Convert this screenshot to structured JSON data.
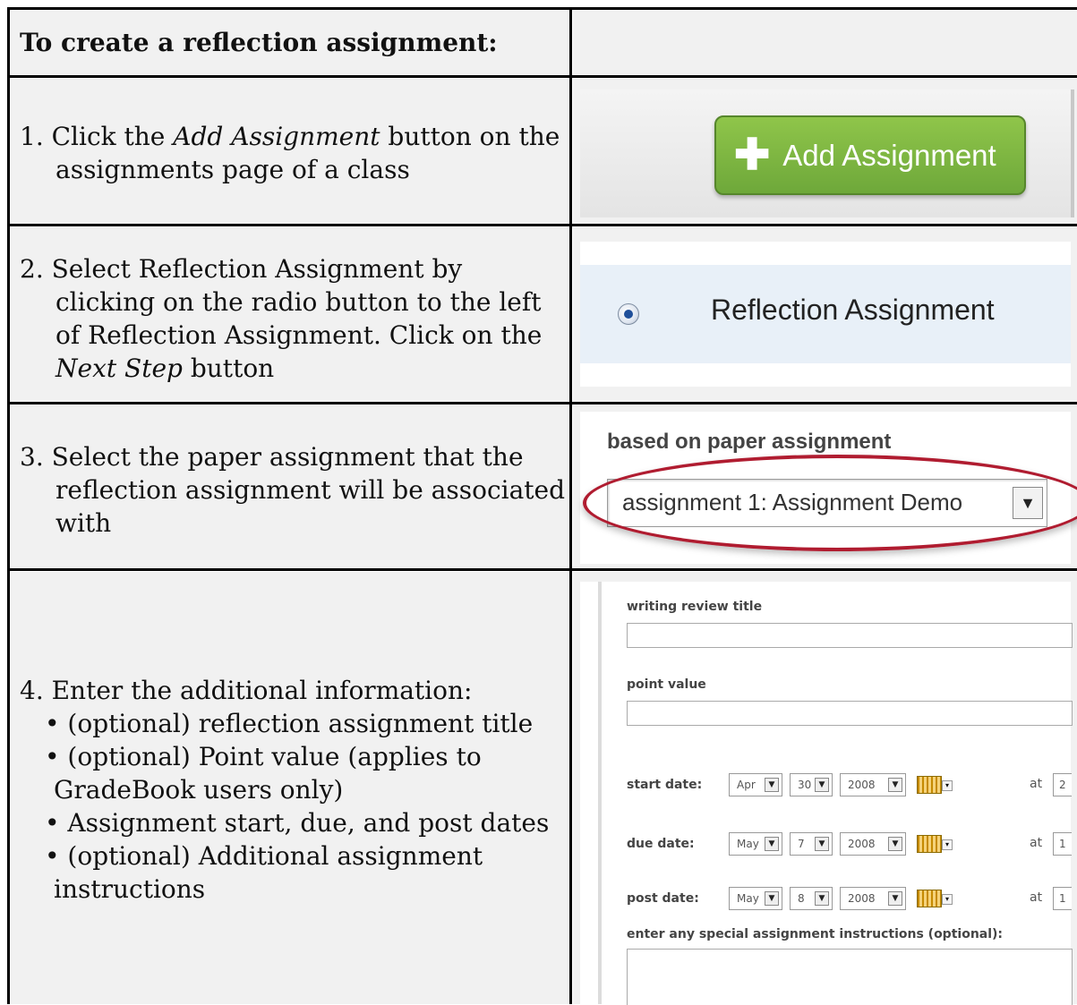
{
  "heading": "To create a reflection assignment:",
  "steps": {
    "s1": {
      "pre": "1. Click the ",
      "em": "Add Assignment",
      "post": " button on the",
      "line2": "assignments page of a class"
    },
    "s2": {
      "l1": "2. Select Reflection Assignment by",
      "l2": "clicking on the radio button to the left",
      "l3": "of Reflection Assignment. Click on the",
      "l4em": "Next Step",
      "l4post": " button"
    },
    "s3": {
      "l1": "3. Select the paper assignment that the",
      "l2": "reflection assignment will be associated",
      "l3": "with"
    },
    "s4": {
      "l1": "4. Enter the additional information:",
      "b1": "• (optional) reflection assignment title",
      "b2a": "• (optional) Point value (applies to",
      "b2b": "GradeBook users only)",
      "b3": "• Assignment start, due, and post dates",
      "b4a": "• (optional) Additional assignment",
      "b4b": "instructions"
    }
  },
  "shot1": {
    "button_label": "Add Assignment",
    "icon": "plus-icon"
  },
  "shot2": {
    "radio_label": "Reflection Assignment"
  },
  "shot3": {
    "label": "based on paper assignment",
    "selected": "assignment 1: Assignment Demo"
  },
  "shot4": {
    "title_label": "writing review title",
    "points_label": "point value",
    "start_label": "start date:",
    "due_label": "due date:",
    "post_label": "post date:",
    "start": {
      "month": "Apr",
      "day": "30",
      "year": "2008",
      "time": "2"
    },
    "due": {
      "month": "May",
      "day": "7",
      "year": "2008",
      "time": "1"
    },
    "post": {
      "month": "May",
      "day": "8",
      "year": "2008",
      "time": "1"
    },
    "at": "at",
    "instructions_label": "enter any special assignment instructions (optional):"
  },
  "colors": {
    "cell_bg": "#f1f1f1",
    "button_green": "#7ab642",
    "ellipse_red": "#b01c30",
    "radio_band": "#e8f0f8"
  }
}
